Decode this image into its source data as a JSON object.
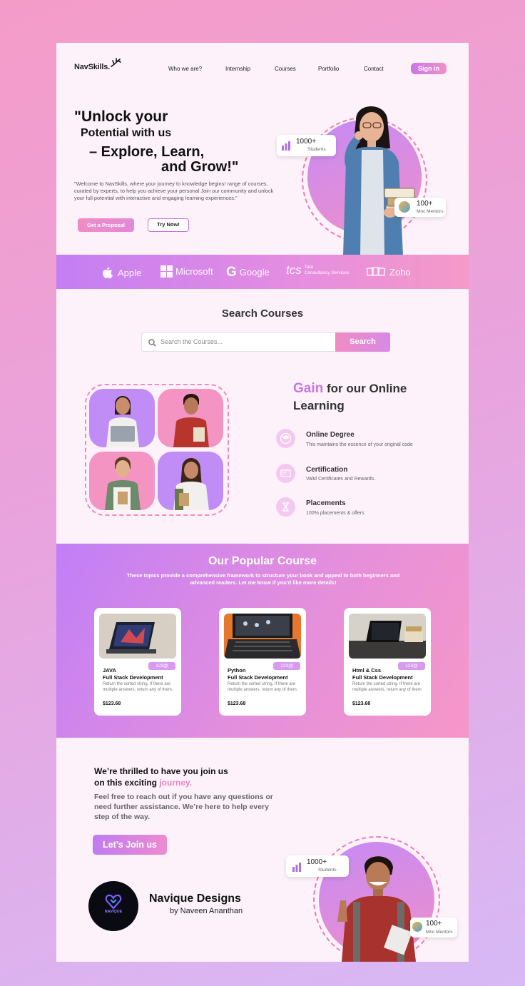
{
  "header": {
    "logo": "NavSkills.",
    "nav": [
      "Who we are?",
      "Internship",
      "Courses",
      "Portfolio",
      "Contact"
    ],
    "signin_label": "Sign in"
  },
  "hero": {
    "line1": "\"Unlock your",
    "line2": "Potential with us",
    "line3": "– Explore, Learn,",
    "line4": "and Grow!\"",
    "description": "\"Welcome to NavSkills, where your journey to knowledge begins! range of courses, curated by experts, to help you achieve your personal Join our community and unlock your full potential with interactive and engaging learning experiences.\"",
    "btn_proposal": "Get a Proposal",
    "btn_try": "Try Now!",
    "stat_students_value": "1000+",
    "stat_students_label": "Students",
    "stat_mentors_value": "100+",
    "stat_mentors_label": "Mnc Mentors"
  },
  "brands": [
    {
      "name": "Apple",
      "icon": "apple-icon"
    },
    {
      "name": "Microsoft",
      "icon": "microsoft-icon"
    },
    {
      "name": "Google",
      "icon": "google-icon"
    },
    {
      "name": "Tata Consultancy Services",
      "short": "tcs",
      "line1": "Tata",
      "line2": "Consultancy Services",
      "icon": "tcs-icon"
    },
    {
      "name": "Zoho",
      "icon": "zoho-icon"
    }
  ],
  "search": {
    "title": "Search Courses",
    "placeholder": "Search the Courses...",
    "button": "Search"
  },
  "gain": {
    "highlight": "Gain",
    "title_rest": " for our Online",
    "title_line2": "Learning",
    "features": [
      {
        "title": "Online Degree",
        "subtitle": "This maintains the essence of your original code",
        "icon": "graduation-cap-icon"
      },
      {
        "title": "Certification",
        "subtitle": "Valid Certificates and Rewards.",
        "icon": "certificate-icon"
      },
      {
        "title": "Placements",
        "subtitle": "100% placements & offers",
        "icon": "placement-icon"
      }
    ]
  },
  "popular": {
    "title": "Our Popular Course",
    "subtitle": "These topics provide a comprehensive framework to structure your book and appeal to both beginners and advanced readers. Let me know if you'd like more details!",
    "courses": [
      {
        "badge": "123@",
        "line1": "JAVA",
        "line2": "Full Stack Development",
        "desc": "Return the sorted string. If there are multiple answers, return any of them.",
        "price": "$123.68"
      },
      {
        "badge": "123@",
        "line1": "Python",
        "line2": "Full Stack Development",
        "desc": "Return the sorted string. If there are multiple answers, return any of them.",
        "price": "$123.68"
      },
      {
        "badge": "123@",
        "line1": "Html & Css",
        "line2": "Full Stack Development",
        "desc": "Return the sorted string. If there are multiple answers, return any of them.",
        "price": "$123.68"
      }
    ]
  },
  "footer": {
    "join_line1": "We’re thrilled to have you join us",
    "join_line2a": "on this exciting ",
    "join_line2b": "journey.",
    "join_desc": "Feel free to reach out if you have any questions or need further assistance. We’re here to help every step of the way.",
    "join_button": "Let’s Join us",
    "brand_name": "Navique Designs",
    "brand_by": "by Naveen Ananthan",
    "logo_text": "NAVIQUE",
    "stat_students_value": "1000+",
    "stat_students_label": "Students",
    "stat_mentors_value": "100+",
    "stat_mentors_label": "Mnc Mentors"
  },
  "colors": {
    "accent_pink": "#f08cc3",
    "accent_purple": "#c17ef6",
    "page_bg": "#fdf2fa"
  }
}
